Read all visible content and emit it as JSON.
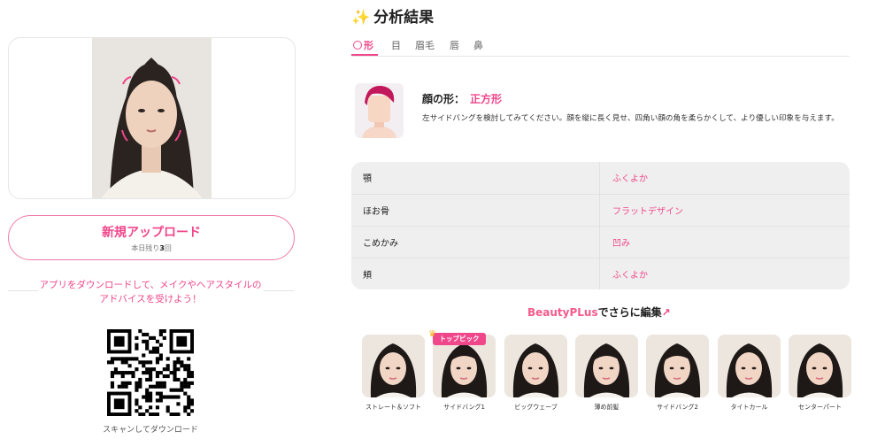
{
  "upload": {
    "label": "新規アップロード",
    "quota_prefix": "本日残り",
    "quota_count": "3",
    "quota_suffix": "回"
  },
  "promo": {
    "text": "アプリをダウンロードして、メイクやヘアスタイルのアドバイスを受けよう！"
  },
  "qr": {
    "caption": "スキャンしてダウンロード"
  },
  "analysis": {
    "title_icon": "sparkles-icon",
    "title": "分析結果",
    "tabs": [
      {
        "label": "形",
        "active": true
      },
      {
        "label": "目"
      },
      {
        "label": "眉毛"
      },
      {
        "label": "唇"
      },
      {
        "label": "鼻"
      }
    ],
    "face_shape_label": "顔の形：",
    "face_shape_value": "正方形",
    "advice": "左サイドバングを検討してみてください。顔を縦に長く見せ、四角い顔の角を柔らかくして、より優しい印象を与えます。",
    "features": [
      {
        "key": "顎",
        "value": "ふくよか"
      },
      {
        "key": "ほお骨",
        "value": "フラットデザイン"
      },
      {
        "key": "こめかみ",
        "value": "凹み"
      },
      {
        "key": "頬",
        "value": "ふくよか"
      }
    ]
  },
  "beautyplus": {
    "brand": "BeautyPLus",
    "suffix": "でさらに編集",
    "badge": "トップピック",
    "styles": [
      {
        "label": "ストレート＆ソフト"
      },
      {
        "label": "サイドバング1"
      },
      {
        "label": "ビッグウェーブ"
      },
      {
        "label": "薄め前髪"
      },
      {
        "label": "サイドバング2"
      },
      {
        "label": "タイトカール"
      },
      {
        "label": "センターパート"
      }
    ]
  },
  "colors": {
    "accent": "#f0468a",
    "brand": "#f55a8c",
    "table_bg": "#efefef"
  }
}
